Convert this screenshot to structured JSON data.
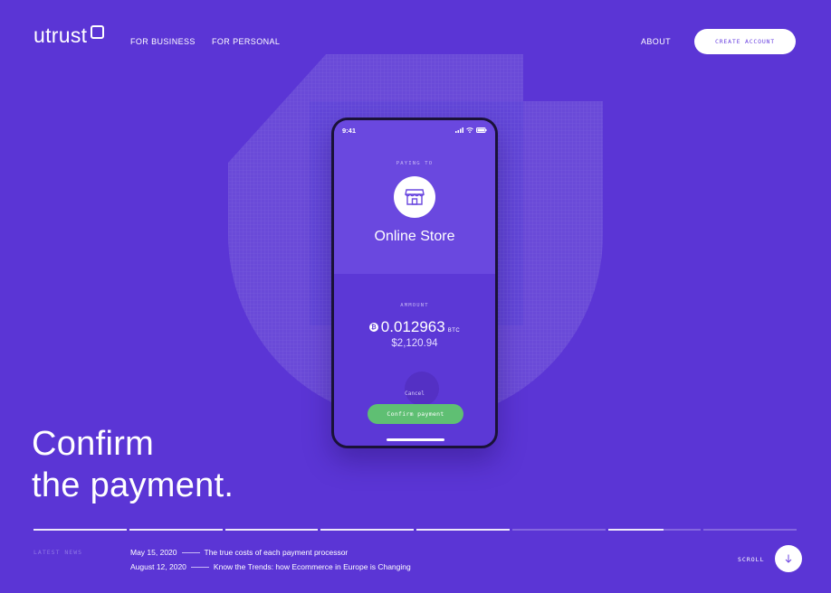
{
  "header": {
    "logo_text": "utrust",
    "nav_items": [
      "FOR BUSINESS",
      "FOR PERSONAL"
    ],
    "about_label": "ABOUT",
    "cta_label": "CREATE ACCOUNT"
  },
  "phone": {
    "status_time": "9:41",
    "paying_to_label": "PAYING TO",
    "store_icon": "storefront-icon",
    "store_name": "Online Store",
    "amount_label": "AMMOUNT",
    "btc_symbol": "₿",
    "btc_amount": "0.012963",
    "btc_unit": "BTC",
    "usd_amount": "$2,120.94",
    "cancel_label": "Cancel",
    "confirm_label": "Confirm payment"
  },
  "hero": {
    "line1": "Confirm",
    "line2": "the payment."
  },
  "progress": {
    "segments": 8,
    "fills": [
      1,
      1,
      1,
      1,
      1,
      0,
      0.6,
      0
    ]
  },
  "news": {
    "label": "LATEST NEWS",
    "items": [
      {
        "date": "May 15, 2020",
        "title": "The true costs of each payment processor"
      },
      {
        "date": "August 12, 2020",
        "title": "Know the Trends: how Ecommerce in Europe is Changing"
      }
    ]
  },
  "scroll": {
    "label": "SCROLL",
    "icon": "arrow-down-icon"
  },
  "colors": {
    "background": "#5b35d5",
    "accent_green": "#5fbf73",
    "phone_frame": "#1a1238"
  }
}
